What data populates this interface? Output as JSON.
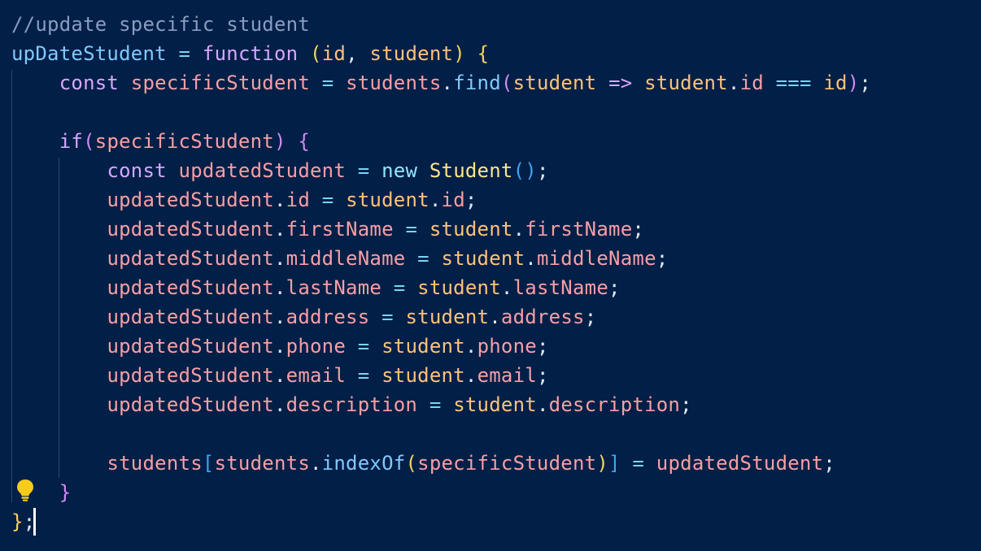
{
  "editor": {
    "lines": [
      [
        {
          "t": "//update specific student",
          "c": "comment"
        }
      ],
      [
        {
          "t": "upDateStudent",
          "c": "func"
        },
        {
          "t": " ",
          "c": "plain"
        },
        {
          "t": "=",
          "c": "op"
        },
        {
          "t": " ",
          "c": "plain"
        },
        {
          "t": "function",
          "c": "key"
        },
        {
          "t": " ",
          "c": "plain"
        },
        {
          "t": "(",
          "c": "b1"
        },
        {
          "t": "id",
          "c": "param"
        },
        {
          "t": ", ",
          "c": "plain"
        },
        {
          "t": "student",
          "c": "param"
        },
        {
          "t": ")",
          "c": "b1"
        },
        {
          "t": " ",
          "c": "plain"
        },
        {
          "t": "{",
          "c": "b1"
        }
      ],
      [
        {
          "t": "    ",
          "c": "plain"
        },
        {
          "t": "const",
          "c": "key"
        },
        {
          "t": " ",
          "c": "plain"
        },
        {
          "t": "specificStudent",
          "c": "var"
        },
        {
          "t": " ",
          "c": "plain"
        },
        {
          "t": "=",
          "c": "op"
        },
        {
          "t": " ",
          "c": "plain"
        },
        {
          "t": "students",
          "c": "var"
        },
        {
          "t": ".",
          "c": "plain"
        },
        {
          "t": "find",
          "c": "func"
        },
        {
          "t": "(",
          "c": "b2"
        },
        {
          "t": "student",
          "c": "param"
        },
        {
          "t": " ",
          "c": "plain"
        },
        {
          "t": "=>",
          "c": "key"
        },
        {
          "t": " ",
          "c": "plain"
        },
        {
          "t": "student",
          "c": "param"
        },
        {
          "t": ".",
          "c": "plain"
        },
        {
          "t": "id",
          "c": "var"
        },
        {
          "t": " ",
          "c": "plain"
        },
        {
          "t": "===",
          "c": "op"
        },
        {
          "t": " ",
          "c": "plain"
        },
        {
          "t": "id",
          "c": "param"
        },
        {
          "t": ")",
          "c": "b2"
        },
        {
          "t": ";",
          "c": "plain"
        }
      ],
      [],
      [
        {
          "t": "    ",
          "c": "plain"
        },
        {
          "t": "if",
          "c": "key"
        },
        {
          "t": "(",
          "c": "b2"
        },
        {
          "t": "specificStudent",
          "c": "var"
        },
        {
          "t": ")",
          "c": "b2"
        },
        {
          "t": " ",
          "c": "plain"
        },
        {
          "t": "{",
          "c": "b2"
        }
      ],
      [
        {
          "t": "        ",
          "c": "plain"
        },
        {
          "t": "const",
          "c": "key"
        },
        {
          "t": " ",
          "c": "plain"
        },
        {
          "t": "updatedStudent",
          "c": "var"
        },
        {
          "t": " ",
          "c": "plain"
        },
        {
          "t": "=",
          "c": "op"
        },
        {
          "t": " ",
          "c": "plain"
        },
        {
          "t": "new",
          "c": "new"
        },
        {
          "t": " ",
          "c": "plain"
        },
        {
          "t": "Student",
          "c": "class"
        },
        {
          "t": "()",
          "c": "b3"
        },
        {
          "t": ";",
          "c": "plain"
        }
      ],
      [
        {
          "t": "        ",
          "c": "plain"
        },
        {
          "t": "updatedStudent",
          "c": "var"
        },
        {
          "t": ".",
          "c": "plain"
        },
        {
          "t": "id",
          "c": "var"
        },
        {
          "t": " ",
          "c": "plain"
        },
        {
          "t": "=",
          "c": "op"
        },
        {
          "t": " ",
          "c": "plain"
        },
        {
          "t": "student",
          "c": "param"
        },
        {
          "t": ".",
          "c": "plain"
        },
        {
          "t": "id",
          "c": "var"
        },
        {
          "t": ";",
          "c": "plain"
        }
      ],
      [
        {
          "t": "        ",
          "c": "plain"
        },
        {
          "t": "updatedStudent",
          "c": "var"
        },
        {
          "t": ".",
          "c": "plain"
        },
        {
          "t": "firstName",
          "c": "var"
        },
        {
          "t": " ",
          "c": "plain"
        },
        {
          "t": "=",
          "c": "op"
        },
        {
          "t": " ",
          "c": "plain"
        },
        {
          "t": "student",
          "c": "param"
        },
        {
          "t": ".",
          "c": "plain"
        },
        {
          "t": "firstName",
          "c": "var"
        },
        {
          "t": ";",
          "c": "plain"
        }
      ],
      [
        {
          "t": "        ",
          "c": "plain"
        },
        {
          "t": "updatedStudent",
          "c": "var"
        },
        {
          "t": ".",
          "c": "plain"
        },
        {
          "t": "middleName",
          "c": "var"
        },
        {
          "t": " ",
          "c": "plain"
        },
        {
          "t": "=",
          "c": "op"
        },
        {
          "t": " ",
          "c": "plain"
        },
        {
          "t": "student",
          "c": "param"
        },
        {
          "t": ".",
          "c": "plain"
        },
        {
          "t": "middleName",
          "c": "var"
        },
        {
          "t": ";",
          "c": "plain"
        }
      ],
      [
        {
          "t": "        ",
          "c": "plain"
        },
        {
          "t": "updatedStudent",
          "c": "var"
        },
        {
          "t": ".",
          "c": "plain"
        },
        {
          "t": "lastName",
          "c": "var"
        },
        {
          "t": " ",
          "c": "plain"
        },
        {
          "t": "=",
          "c": "op"
        },
        {
          "t": " ",
          "c": "plain"
        },
        {
          "t": "student",
          "c": "param"
        },
        {
          "t": ".",
          "c": "plain"
        },
        {
          "t": "lastName",
          "c": "var"
        },
        {
          "t": ";",
          "c": "plain"
        }
      ],
      [
        {
          "t": "        ",
          "c": "plain"
        },
        {
          "t": "updatedStudent",
          "c": "var"
        },
        {
          "t": ".",
          "c": "plain"
        },
        {
          "t": "address",
          "c": "var"
        },
        {
          "t": " ",
          "c": "plain"
        },
        {
          "t": "=",
          "c": "op"
        },
        {
          "t": " ",
          "c": "plain"
        },
        {
          "t": "student",
          "c": "param"
        },
        {
          "t": ".",
          "c": "plain"
        },
        {
          "t": "address",
          "c": "var"
        },
        {
          "t": ";",
          "c": "plain"
        }
      ],
      [
        {
          "t": "        ",
          "c": "plain"
        },
        {
          "t": "updatedStudent",
          "c": "var"
        },
        {
          "t": ".",
          "c": "plain"
        },
        {
          "t": "phone",
          "c": "var"
        },
        {
          "t": " ",
          "c": "plain"
        },
        {
          "t": "=",
          "c": "op"
        },
        {
          "t": " ",
          "c": "plain"
        },
        {
          "t": "student",
          "c": "param"
        },
        {
          "t": ".",
          "c": "plain"
        },
        {
          "t": "phone",
          "c": "var"
        },
        {
          "t": ";",
          "c": "plain"
        }
      ],
      [
        {
          "t": "        ",
          "c": "plain"
        },
        {
          "t": "updatedStudent",
          "c": "var"
        },
        {
          "t": ".",
          "c": "plain"
        },
        {
          "t": "email",
          "c": "var"
        },
        {
          "t": " ",
          "c": "plain"
        },
        {
          "t": "=",
          "c": "op"
        },
        {
          "t": " ",
          "c": "plain"
        },
        {
          "t": "student",
          "c": "param"
        },
        {
          "t": ".",
          "c": "plain"
        },
        {
          "t": "email",
          "c": "var"
        },
        {
          "t": ";",
          "c": "plain"
        }
      ],
      [
        {
          "t": "        ",
          "c": "plain"
        },
        {
          "t": "updatedStudent",
          "c": "var"
        },
        {
          "t": ".",
          "c": "plain"
        },
        {
          "t": "description",
          "c": "var"
        },
        {
          "t": " ",
          "c": "plain"
        },
        {
          "t": "=",
          "c": "op"
        },
        {
          "t": " ",
          "c": "plain"
        },
        {
          "t": "student",
          "c": "param"
        },
        {
          "t": ".",
          "c": "plain"
        },
        {
          "t": "description",
          "c": "var"
        },
        {
          "t": ";",
          "c": "plain"
        }
      ],
      [],
      [
        {
          "t": "        ",
          "c": "plain"
        },
        {
          "t": "students",
          "c": "var"
        },
        {
          "t": "[",
          "c": "b3"
        },
        {
          "t": "students",
          "c": "var"
        },
        {
          "t": ".",
          "c": "plain"
        },
        {
          "t": "indexOf",
          "c": "func"
        },
        {
          "t": "(",
          "c": "b1"
        },
        {
          "t": "specificStudent",
          "c": "var"
        },
        {
          "t": ")",
          "c": "b1"
        },
        {
          "t": "]",
          "c": "b3"
        },
        {
          "t": " ",
          "c": "plain"
        },
        {
          "t": "=",
          "c": "op"
        },
        {
          "t": " ",
          "c": "plain"
        },
        {
          "t": "updatedStudent",
          "c": "var"
        },
        {
          "t": ";",
          "c": "plain"
        }
      ],
      [
        {
          "t": "    ",
          "c": "plain"
        },
        {
          "t": "}",
          "c": "b2"
        }
      ],
      [
        {
          "t": "}",
          "c": "b1"
        },
        {
          "t": ";",
          "c": "plain"
        }
      ]
    ],
    "current_line": 18,
    "lightbulb_line": 17,
    "colors": {
      "background": "#011f47",
      "current_line_highlight": "#012b5e",
      "lightbulb": "#f7cb1c"
    }
  }
}
